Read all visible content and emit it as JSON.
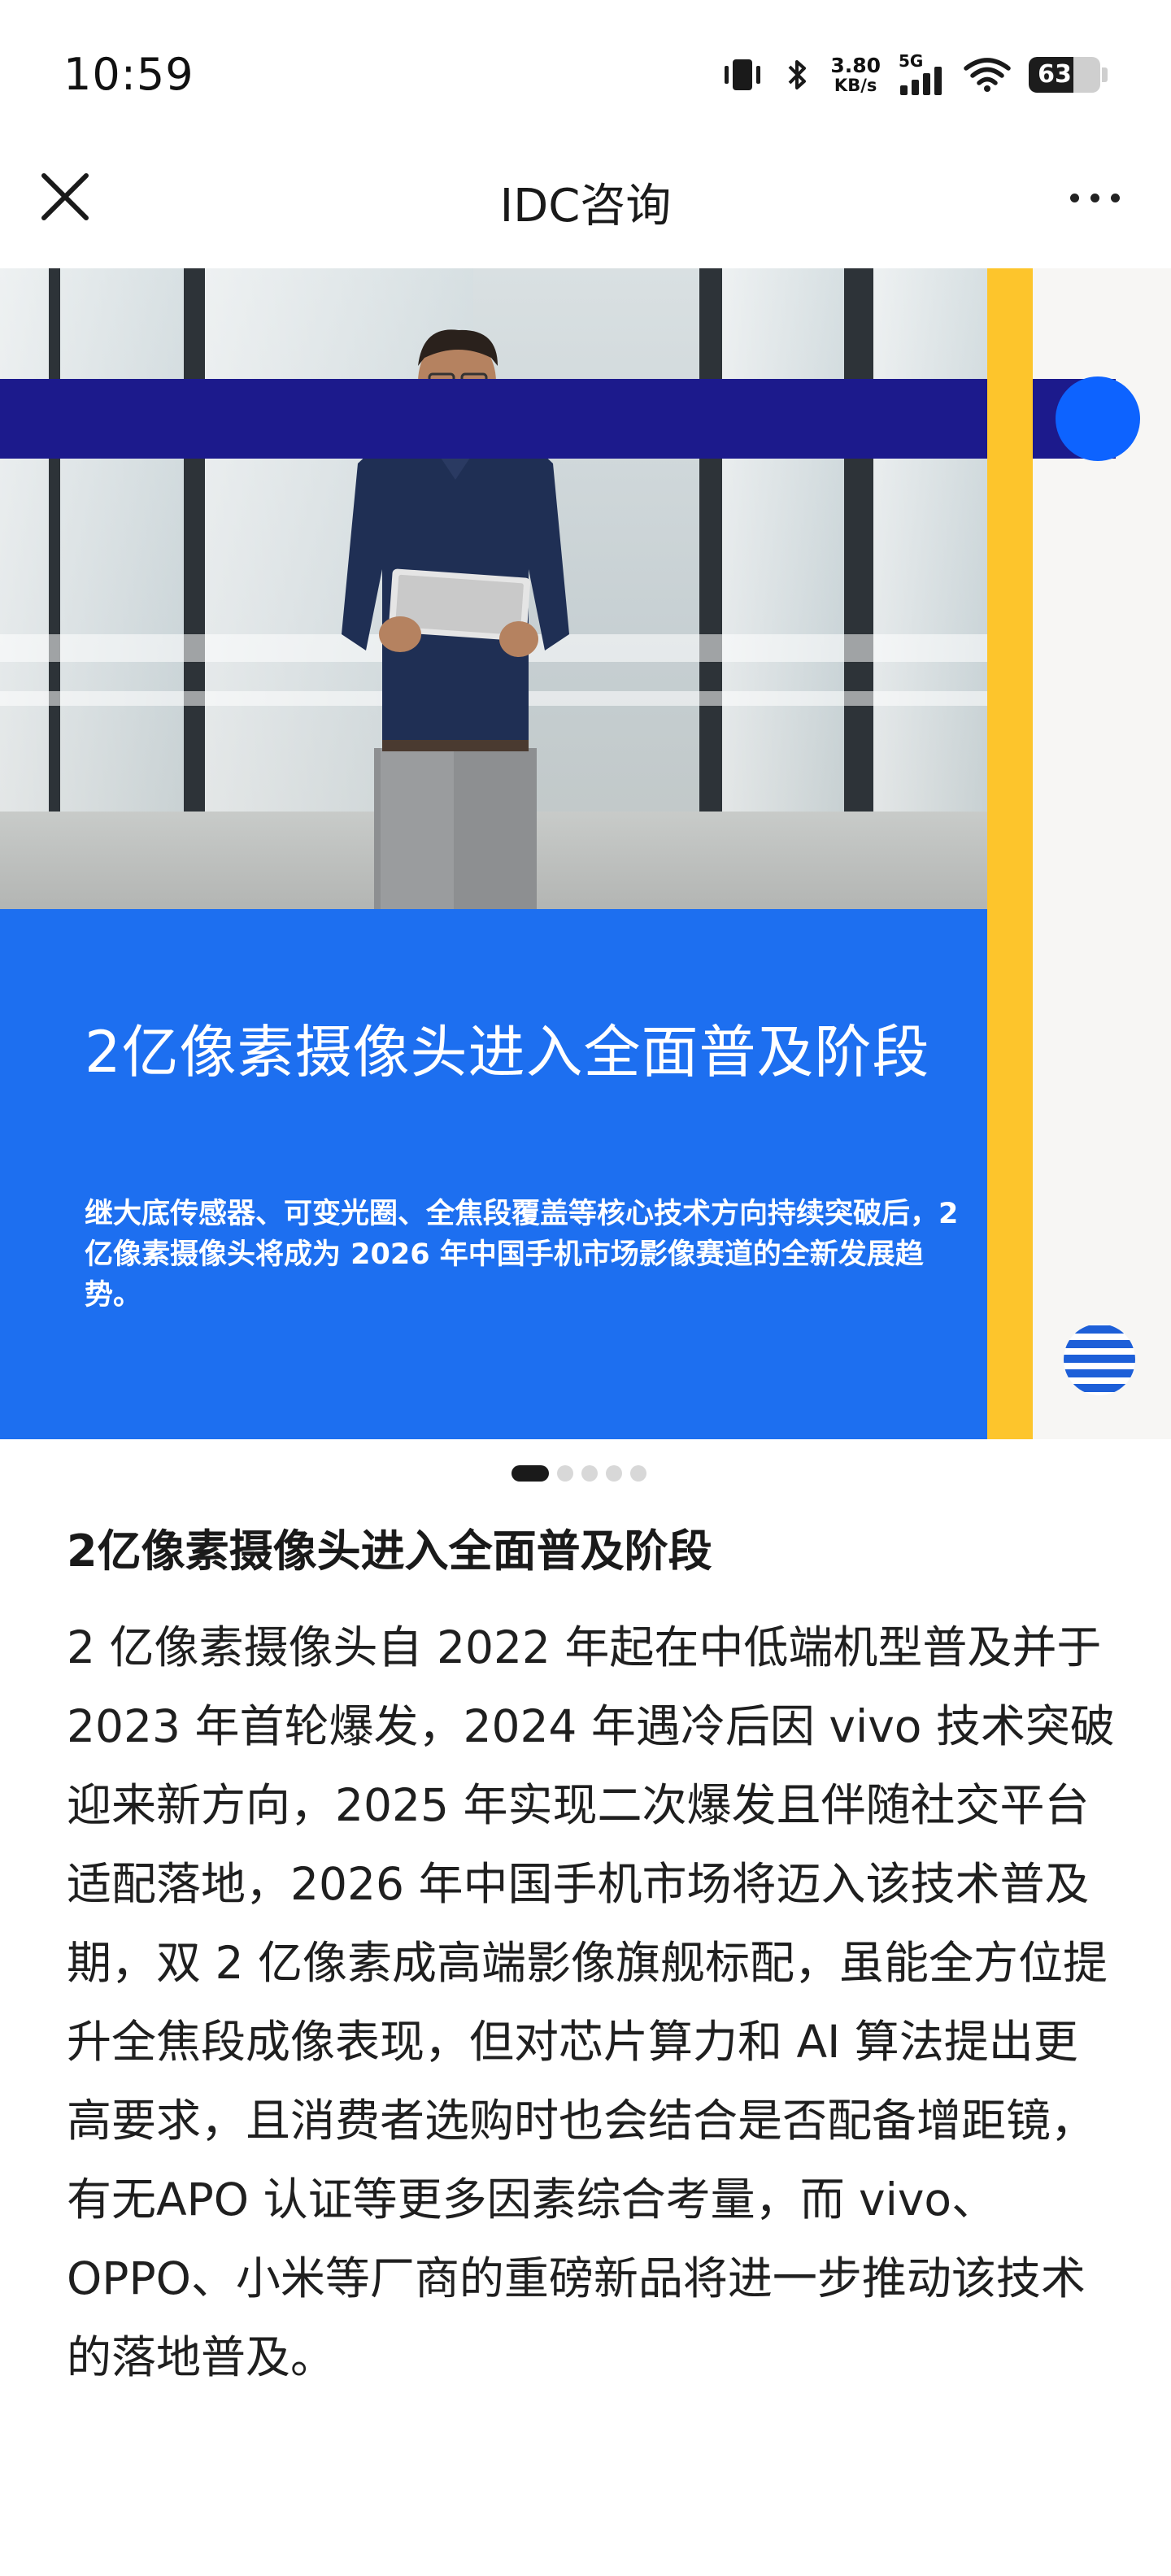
{
  "status_bar": {
    "time": "10:59",
    "net_speed_value": "3.80",
    "net_speed_unit": "KB/s",
    "network_type": "5G",
    "battery_level": "63"
  },
  "header": {
    "title": "IDC咨询",
    "close_icon": "close-icon",
    "more_icon": "more-icon"
  },
  "banner": {
    "heading": "2亿像素摄像头进入全面普及阶段",
    "description": "继大底传感器、可变光圈、全焦段覆盖等核心技术方向持续突破后，2 亿像素摄像头将成为 2026 年中国手机市场影像赛道的全新发展趋势。",
    "colors": {
      "navy": "#1c1a8c",
      "blue": "#1d6ff0",
      "yellow": "#fdc52c",
      "dot": "#0d63ff"
    }
  },
  "carousel": {
    "total": 5,
    "active_index": 0
  },
  "article": {
    "title": "2亿像素摄像头进入全面普及阶段",
    "body": "2 亿像素摄像头自 2022 年起在中低端机型普及并于 2023 年首轮爆发，2024 年遇冷后因 vivo 技术突破迎来新方向，2025 年实现二次爆发且伴随社交平台适配落地，2026 年中国手机市场将迈入该技术普及期，双 2 亿像素成高端影像旗舰标配，虽能全方位提升全焦段成像表现，但对芯片算力和 AI 算法提出更高要求，且消费者选购时也会结合是否配备增距镜，有无APO 认证等更多因素综合考量，而 vivo、OPPO、小米等厂商的重磅新品将进一步推动该技术的落地普及。"
  }
}
